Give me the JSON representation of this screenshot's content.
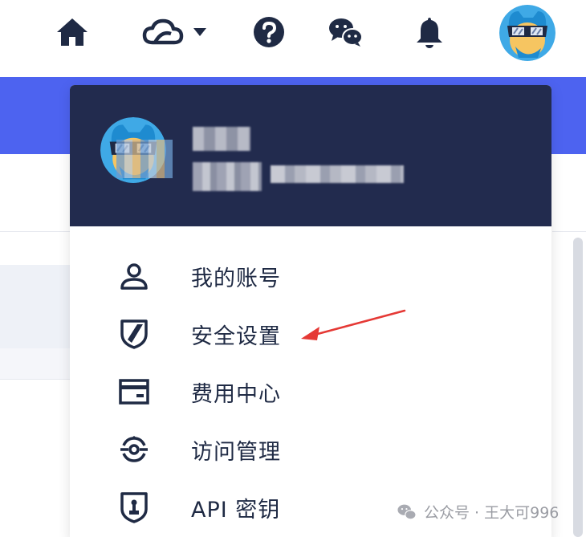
{
  "topbar": {
    "icons": [
      "home-icon",
      "cloud-icon",
      "help-icon",
      "wechat-icon",
      "bell-icon"
    ],
    "cloud_dropdown_icon": "caret-down-icon"
  },
  "account_dropdown": {
    "menu": [
      {
        "label": "我的账号",
        "icon": "user-icon"
      },
      {
        "label": "安全设置",
        "icon": "shield-icon"
      },
      {
        "label": "费用中心",
        "icon": "card-icon"
      },
      {
        "label": "访问管理",
        "icon": "access-icon"
      },
      {
        "label": "API 密钥",
        "icon": "key-shield-icon"
      }
    ]
  },
  "annotation": {
    "color": "#e53935"
  },
  "watermark": {
    "text": "公众号 · 王大可996"
  },
  "colors": {
    "header_dark": "#222b4e",
    "accent_blue": "#4d63f0",
    "icon_dark": "#1f2a44"
  }
}
